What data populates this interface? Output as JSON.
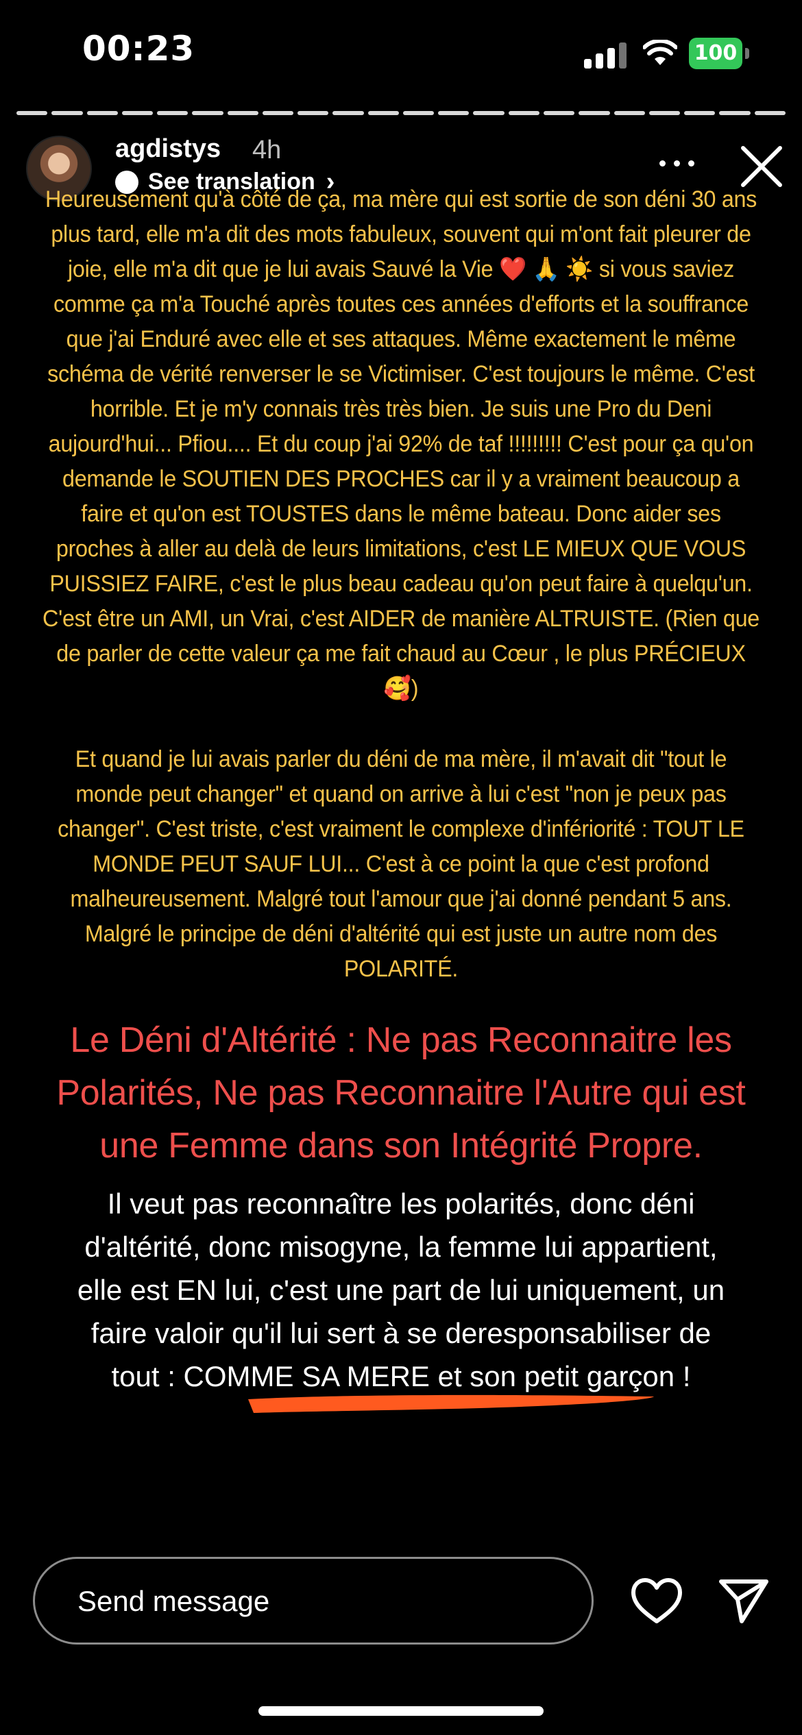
{
  "status_bar": {
    "time": "00:23",
    "battery": "100",
    "battery_color": "#33c759"
  },
  "story": {
    "segments_total": 22,
    "username": "agdistys",
    "time_ago": "4h",
    "translate_label": "See translation",
    "para1": "Heureusement qu'à côté de ça, ma mère qui est sortie de son déni 30 ans plus tard, elle m'a dit des mots fabuleux, souvent qui m'ont fait pleurer de joie, elle m'a dit que je lui avais Sauvé la Vie ❤️ 🙏 ☀️ si vous saviez comme ça m'a Touché après toutes ces années d'efforts et la souffrance que j'ai Enduré avec elle et ses attaques. Même exactement le même schéma de vérité renverser le se Victimiser. C'est toujours le même. C'est horrible. Et je m'y connais très très bien. Je suis une Pro du Deni aujourd'hui... Pfiou.... Et du coup j'ai 92% de taf !!!!!!!!! C'est pour ça qu'on demande le SOUTIEN DES PROCHES car il y a vraiment beaucoup a faire et qu'on est TOUSTES dans le même bateau. Donc aider ses proches à aller au delà de leurs limitations, c'est LE MIEUX QUE VOUS PUISSIEZ FAIRE, c'est le plus beau cadeau qu'on peut faire à quelqu'un. C'est être un AMI, un Vrai, c'est AIDER de manière ALTRUISTE. (Rien que de parler de cette valeur ça me fait chaud au Cœur , le plus PRÉCIEUX 🥰)",
    "para2": "Et quand je lui avais parler du déni de ma mère,  il m'avait dit \"tout le monde peut changer\" et quand on arrive à lui c'est \"non je peux pas changer\". C'est triste, c'est vraiment le complexe d'infériorité : TOUT LE MONDE PEUT SAUF LUI... C'est à ce point la que c'est profond malheureusement. Malgré tout l'amour que j'ai donné pendant 5 ans. Malgré le principe de déni d'altérité qui est juste un autre nom des POLARITÉ.",
    "heading_red": "Le Déni d'Altérité :  Ne pas Reconnaitre les Polarités, Ne pas Reconnaitre l'Autre qui est une Femme dans son Intégrité Propre.",
    "para_white": "Il veut pas reconnaître les polarités, donc déni d'altérité, donc misogyne, la femme lui appartient, elle est EN lui, c'est une part de lui uniquement, un faire valoir qu'il lui sert à se deresponsabiliser de tout : COMME SA MERE et son petit garçon !",
    "accent_yellow": "#f6c24a",
    "accent_red": "#ee4f4c",
    "underline_color": "#ff5a1f"
  },
  "footer": {
    "message_placeholder": "Send message"
  }
}
